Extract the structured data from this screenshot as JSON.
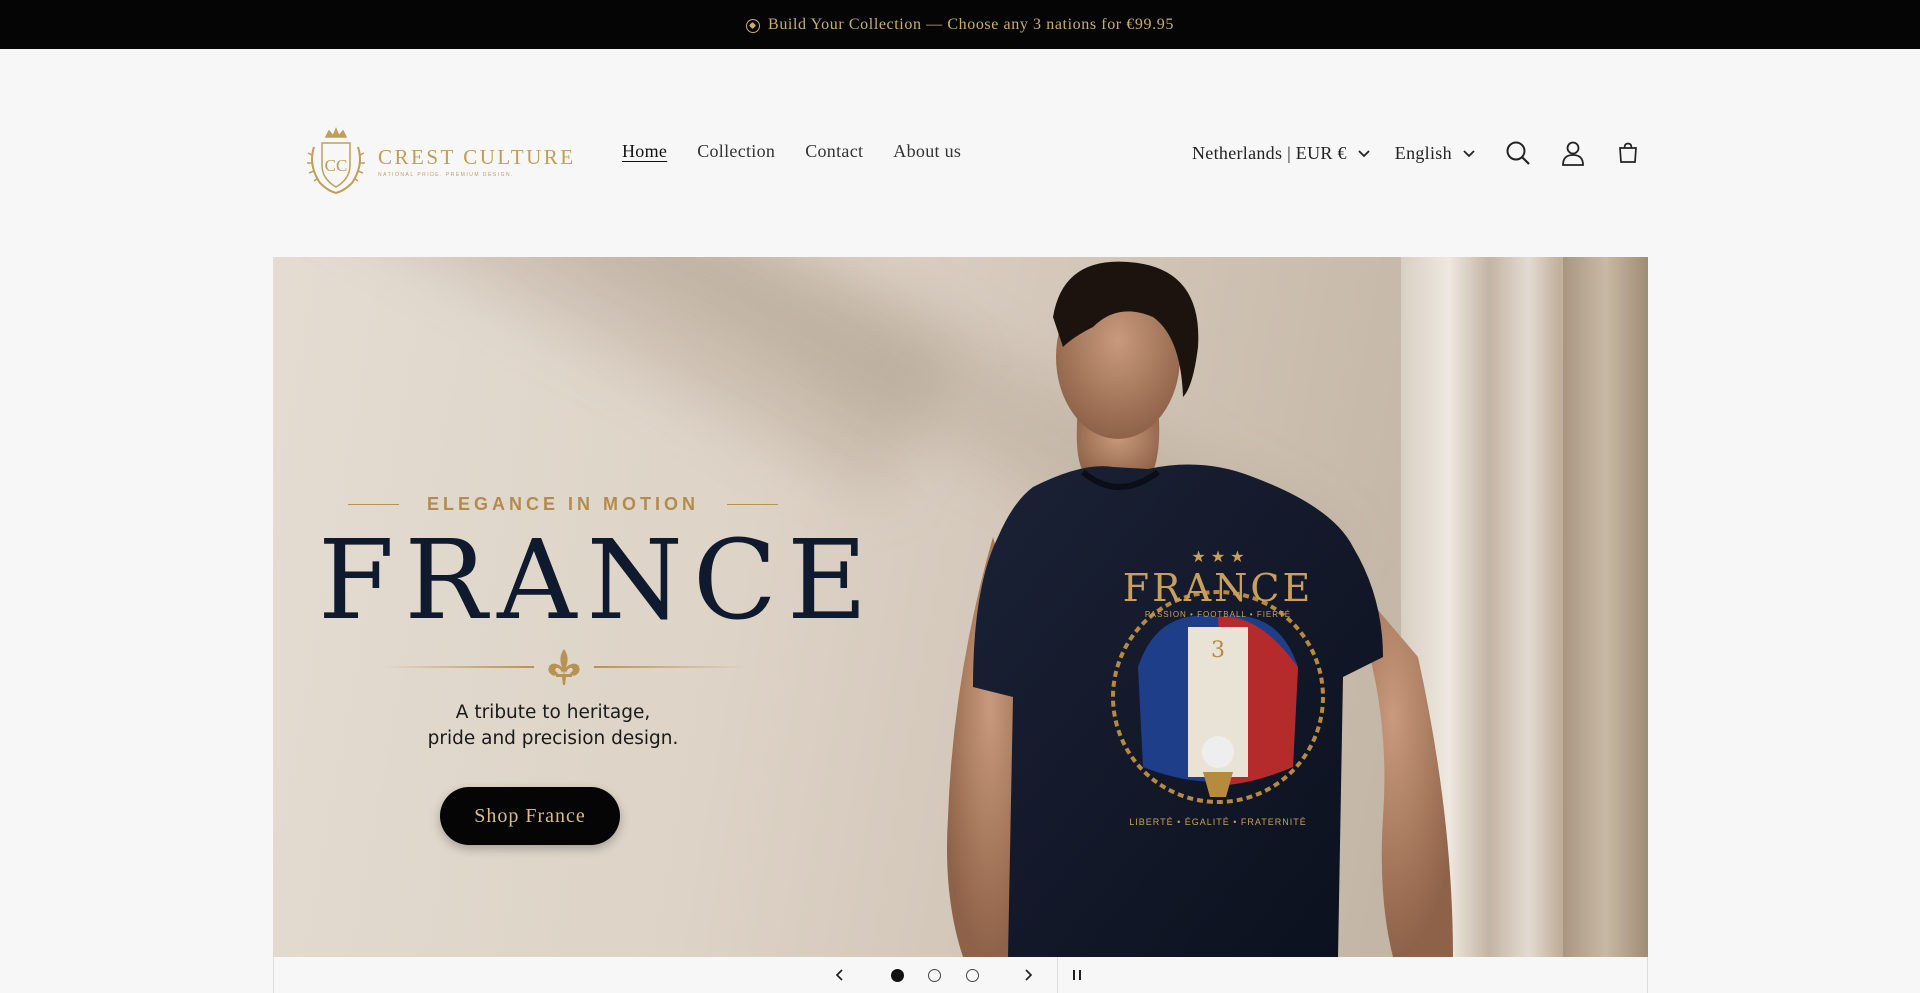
{
  "announcement": {
    "icon": "soccer-ball-icon",
    "text": "Build Your Collection — Choose any 3 nations for €99.95"
  },
  "logo": {
    "name": "CREST CULTURE",
    "tagline": "NATIONAL PRIDE. PREMIUM DESIGN.",
    "monogram": "CC"
  },
  "nav": {
    "items": [
      {
        "label": "Home",
        "active": true
      },
      {
        "label": "Collection",
        "active": false
      },
      {
        "label": "Contact",
        "active": false
      },
      {
        "label": "About us",
        "active": false
      }
    ]
  },
  "header": {
    "country_label": "Netherlands | EUR €",
    "language_label": "English",
    "icons": [
      "search-icon",
      "account-icon",
      "cart-icon"
    ]
  },
  "hero": {
    "eyebrow": "ELEGANCE IN MOTION",
    "title": "FRANCE",
    "subtitle_line1": "A tribute to heritage,",
    "subtitle_line2": "pride and precision design.",
    "cta_label": "Shop France",
    "shirt_title": "FRANCE",
    "shirt_tagline": "PASSION • FOOTBALL • FIERTÉ",
    "shirt_motto": "LIBERTÉ • ÉGALITÉ • FRATERNITÉ",
    "shirt_stars": "3"
  },
  "slider": {
    "slide_count": 3,
    "active_index": 0
  },
  "colors": {
    "gold": "#c29d57",
    "navy": "#101a2e",
    "black": "#050505"
  }
}
